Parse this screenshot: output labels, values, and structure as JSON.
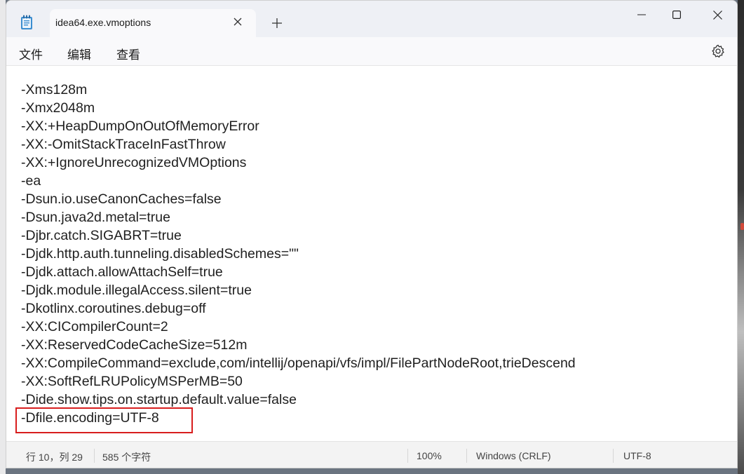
{
  "window": {
    "tab_title": "idea64.exe.vmoptions",
    "icons": {
      "app": "notepad-icon",
      "close_tab": "close-icon",
      "new_tab": "plus-icon",
      "minimize": "minimize-icon",
      "maximize": "maximize-icon",
      "close_window": "close-icon"
    }
  },
  "menu": {
    "items": [
      "文件",
      "编辑",
      "查看"
    ],
    "settings_icon": "gear-icon"
  },
  "editor": {
    "lines": [
      "-Xms128m",
      "-Xmx2048m",
      "-XX:+HeapDumpOnOutOfMemoryError",
      "-XX:-OmitStackTraceInFastThrow",
      "-XX:+IgnoreUnrecognizedVMOptions",
      "-ea",
      "-Dsun.io.useCanonCaches=false",
      "-Dsun.java2d.metal=true",
      "-Djbr.catch.SIGABRT=true",
      "-Djdk.http.auth.tunneling.disabledSchemes=\"\"",
      "-Djdk.attach.allowAttachSelf=true",
      "-Djdk.module.illegalAccess.silent=true",
      "-Dkotlinx.coroutines.debug=off",
      "-XX:CICompilerCount=2",
      "-XX:ReservedCodeCacheSize=512m",
      "-XX:CompileCommand=exclude,com/intellij/openapi/vfs/impl/FilePartNodeRoot,trieDescend",
      "-XX:SoftRefLRUPolicyMSPerMB=50",
      "-Dide.show.tips.on.startup.default.value=false",
      "-Dfile.encoding=UTF-8"
    ],
    "highlight_color": "#d81e1e"
  },
  "status": {
    "position": "行 10，列 29",
    "char_count": "585 个字符",
    "zoom": "100%",
    "line_ending": "Windows (CRLF)",
    "encoding": "UTF-8"
  }
}
